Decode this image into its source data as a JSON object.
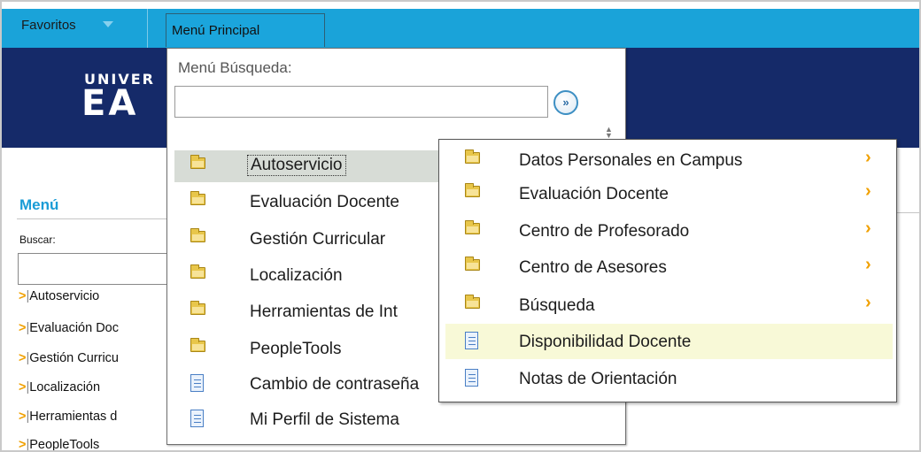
{
  "topbar": {
    "favorites_label": "Favoritos",
    "main_menu_label": "Menú Principal"
  },
  "banner": {
    "logo_line1": "UNIVER",
    "logo_line2": "EA"
  },
  "left_menu": {
    "title": "Menú",
    "search_label": "Buscar:",
    "items": [
      {
        "arrow": ">",
        "sep": "|",
        "label": "Autoservicio"
      },
      {
        "arrow": ">",
        "sep": "|",
        "label": "Evaluación Doc"
      },
      {
        "arrow": ">",
        "sep": "|",
        "label": "Gestión Curricu"
      },
      {
        "arrow": ">",
        "sep": "|",
        "label": "Localización"
      },
      {
        "arrow": ">",
        "sep": "|",
        "label": "Herramientas d"
      },
      {
        "arrow": ">",
        "sep": "|",
        "label": "PeopleTools"
      }
    ]
  },
  "dropdown": {
    "search_label": "Menú Búsqueda:",
    "search_value": "",
    "go_button": "»",
    "items": [
      {
        "icon": "folder-icon",
        "label": "Autoservicio",
        "selected": true
      },
      {
        "icon": "folder-icon",
        "label": "Evaluación Docente"
      },
      {
        "icon": "folder-icon",
        "label": "Gestión Curricular"
      },
      {
        "icon": "folder-icon",
        "label": "Localización"
      },
      {
        "icon": "folder-icon",
        "label": "Herramientas de Int"
      },
      {
        "icon": "folder-icon",
        "label": "PeopleTools"
      },
      {
        "icon": "document-icon",
        "label": "Cambio de contraseña"
      },
      {
        "icon": "document-icon",
        "label": "Mi Perfil de Sistema"
      }
    ]
  },
  "submenu": {
    "items": [
      {
        "icon": "folder-icon",
        "label": "Datos Personales en Campus",
        "has_children": true
      },
      {
        "icon": "folder-icon",
        "label": "Evaluación Docente",
        "has_children": true
      },
      {
        "icon": "folder-icon",
        "label": "Centro de Profesorado",
        "has_children": true
      },
      {
        "icon": "folder-icon",
        "label": "Centro de Asesores",
        "has_children": true
      },
      {
        "icon": "folder-icon",
        "label": "Búsqueda",
        "has_children": true
      },
      {
        "icon": "document-icon",
        "label": "Disponibilidad Docente",
        "highlighted": true
      },
      {
        "icon": "document-icon",
        "label": "Notas de Orientación"
      }
    ],
    "chevron": "›"
  },
  "colors": {
    "topbar": "#1aa3d9",
    "banner": "#152a69",
    "accent_orange": "#f0a000",
    "menu_title": "#1a9cd6",
    "submenu_highlight": "#f8f9d7"
  }
}
